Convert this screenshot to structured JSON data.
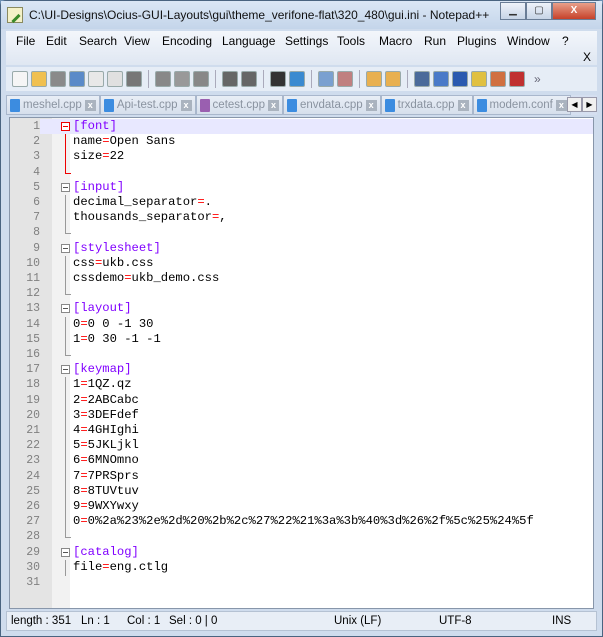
{
  "window": {
    "title": "C:\\UI-Designs\\Ocius-GUI-Layouts\\gui\\theme_verifone-flat\\320_480\\gui.ini - Notepad++",
    "minimize": "▁",
    "maximize": "▢",
    "close": "X"
  },
  "menu": [
    "File",
    "Edit",
    "Search",
    "View",
    "Encoding",
    "Language",
    "Settings",
    "Tools",
    "Macro",
    "Run",
    "Plugins",
    "Window",
    "?"
  ],
  "menu_close": "X",
  "toolbar_icons": [
    "new-file",
    "open-file",
    "save",
    "save-all",
    "close",
    "close-all",
    "print",
    "cut",
    "copy",
    "paste",
    "undo",
    "redo",
    "find",
    "replace",
    "zoom-in",
    "zoom-out",
    "sync-vertical",
    "sync-horizontal",
    "word-wrap",
    "show-all-chars",
    "indent-guide",
    "user-defined-language",
    "doc-map",
    "function-list"
  ],
  "toolbar_more": "»",
  "tabs": [
    {
      "label": "meshel.cpp",
      "color": "#3c8ce0"
    },
    {
      "label": "Api-test.cpp",
      "color": "#3c8ce0"
    },
    {
      "label": "cetest.cpp",
      "color": "#9a5fb0"
    },
    {
      "label": "envdata.cpp",
      "color": "#3c8ce0"
    },
    {
      "label": "trxdata.cpp",
      "color": "#3c8ce0"
    },
    {
      "label": "modem.conf",
      "color": "#3c8ce0"
    }
  ],
  "tab_close": "x",
  "lines": [
    {
      "n": "1",
      "type": "sec",
      "text": "[font]"
    },
    {
      "n": "2",
      "k": "name",
      "v": "Open Sans"
    },
    {
      "n": "3",
      "k": "size",
      "v": "22"
    },
    {
      "n": "4",
      "type": "blank"
    },
    {
      "n": "5",
      "type": "sec",
      "text": "[input]"
    },
    {
      "n": "6",
      "k": "decimal_separator",
      "v": "."
    },
    {
      "n": "7",
      "k": "thousands_separator",
      "v": ","
    },
    {
      "n": "8",
      "type": "blank"
    },
    {
      "n": "9",
      "type": "sec",
      "text": "[stylesheet]"
    },
    {
      "n": "10",
      "k": "css",
      "v": "ukb.css"
    },
    {
      "n": "11",
      "k": "cssdemo",
      "v": "ukb_demo.css"
    },
    {
      "n": "12",
      "type": "blank"
    },
    {
      "n": "13",
      "type": "sec",
      "text": "[layout]"
    },
    {
      "n": "14",
      "k": "0",
      "v": "0 0 -1 30"
    },
    {
      "n": "15",
      "k": "1",
      "v": "0 30 -1 -1"
    },
    {
      "n": "16",
      "type": "blank"
    },
    {
      "n": "17",
      "type": "sec",
      "text": "[keymap]"
    },
    {
      "n": "18",
      "k": "1",
      "v": "1QZ.qz"
    },
    {
      "n": "19",
      "k": "2",
      "v": "2ABCabc"
    },
    {
      "n": "20",
      "k": "3",
      "v": "3DEFdef"
    },
    {
      "n": "21",
      "k": "4",
      "v": "4GHIghi"
    },
    {
      "n": "22",
      "k": "5",
      "v": "5JKLjkl"
    },
    {
      "n": "23",
      "k": "6",
      "v": "6MNOmno"
    },
    {
      "n": "24",
      "k": "7",
      "v": "7PRSprs"
    },
    {
      "n": "25",
      "k": "8",
      "v": "8TUVtuv"
    },
    {
      "n": "26",
      "k": "9",
      "v": "9WXYwxy"
    },
    {
      "n": "27",
      "k": "0",
      "v": "0%2a%23%2e%2d%20%2b%2c%27%22%21%3a%3b%40%3d%26%2f%5c%25%24%5f"
    },
    {
      "n": "28",
      "type": "blank"
    },
    {
      "n": "29",
      "type": "sec",
      "text": "[catalog]"
    },
    {
      "n": "30",
      "k": "file",
      "v": "eng.ctlg"
    },
    {
      "n": "31",
      "type": "end"
    }
  ],
  "status": {
    "length": "length : 351",
    "ln": "Ln : 1",
    "col": "Col : 1",
    "sel": "Sel : 0 | 0",
    "eol": "Unix (LF)",
    "encoding": "UTF-8",
    "mode": "INS"
  }
}
